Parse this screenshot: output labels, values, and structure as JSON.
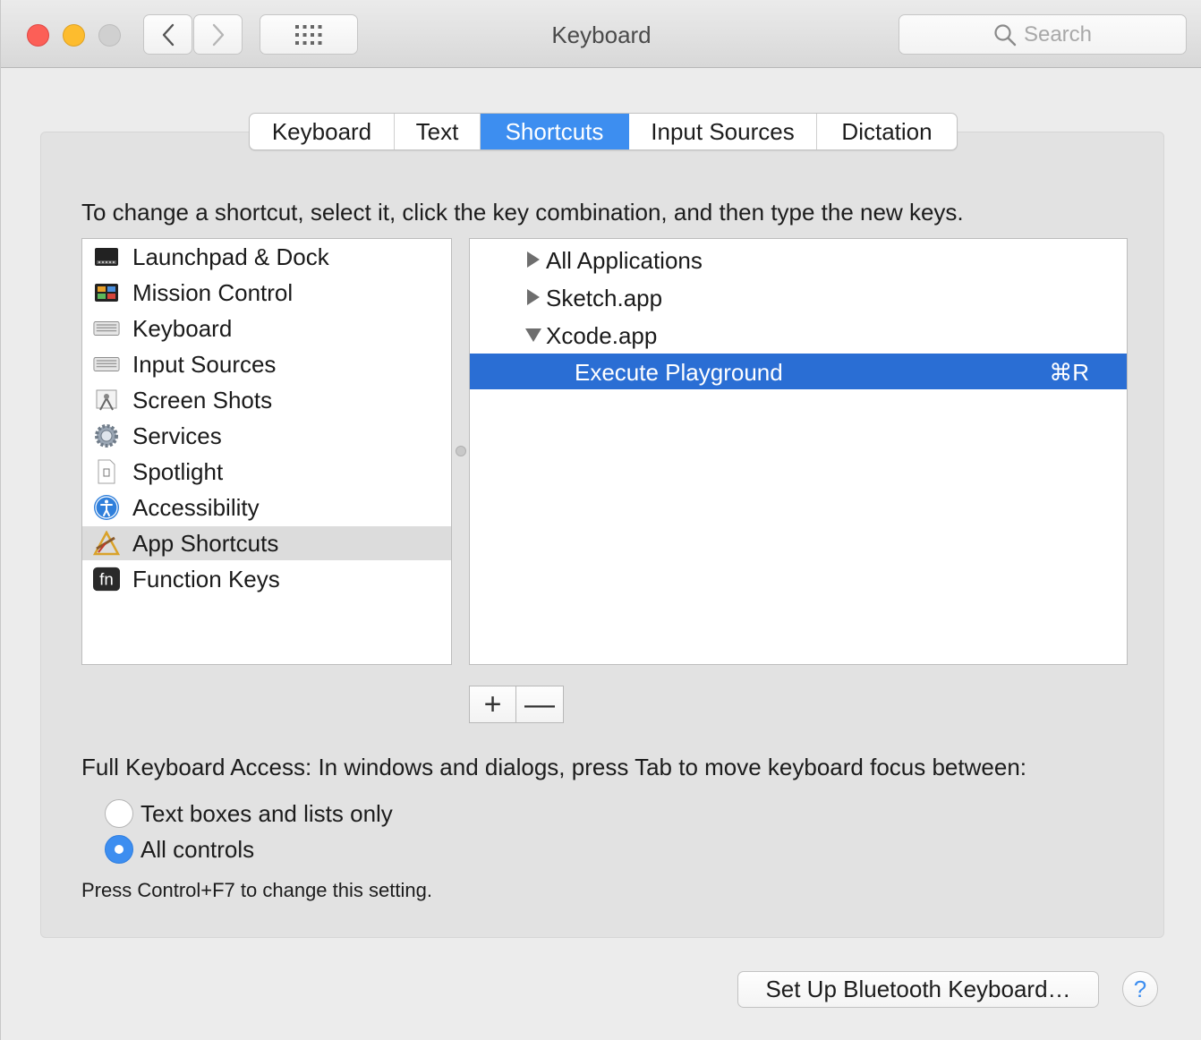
{
  "window": {
    "title": "Keyboard"
  },
  "toolbar": {
    "back_icon": "chevron-left-icon",
    "forward_icon": "chevron-right-icon",
    "grid_icon": "grid-icon",
    "search_placeholder": "Search"
  },
  "tabs": [
    {
      "label": "Keyboard",
      "active": false
    },
    {
      "label": "Text",
      "active": false
    },
    {
      "label": "Shortcuts",
      "active": true
    },
    {
      "label": "Input Sources",
      "active": false
    },
    {
      "label": "Dictation",
      "active": false
    }
  ],
  "instructions": "To change a shortcut, select it, click the key combination, and then type the new keys.",
  "categories": [
    {
      "label": "Launchpad & Dock",
      "icon": "launchpad-dock-icon",
      "selected": false
    },
    {
      "label": "Mission Control",
      "icon": "mission-control-icon",
      "selected": false
    },
    {
      "label": "Keyboard",
      "icon": "keyboard-icon",
      "selected": false
    },
    {
      "label": "Input Sources",
      "icon": "input-sources-icon",
      "selected": false
    },
    {
      "label": "Screen Shots",
      "icon": "screen-shots-icon",
      "selected": false
    },
    {
      "label": "Services",
      "icon": "gear-icon",
      "selected": false
    },
    {
      "label": "Spotlight",
      "icon": "spotlight-icon",
      "selected": false
    },
    {
      "label": "Accessibility",
      "icon": "accessibility-icon",
      "selected": false
    },
    {
      "label": "App Shortcuts",
      "icon": "app-shortcuts-icon",
      "selected": true
    },
    {
      "label": "Function Keys",
      "icon": "fn-key-icon",
      "selected": false
    }
  ],
  "shortcuts": [
    {
      "label": "All Applications",
      "expanded": false
    },
    {
      "label": "Sketch.app",
      "expanded": false
    },
    {
      "label": "Xcode.app",
      "expanded": true
    },
    {
      "label": "Execute Playground",
      "shortcut": "⌘R",
      "selected": true
    }
  ],
  "add_remove": {
    "add": "+",
    "remove": "—"
  },
  "full_keyboard_access": {
    "label": "Full Keyboard Access: In windows and dialogs, press Tab to move keyboard focus between:",
    "options": [
      {
        "label": "Text boxes and lists only",
        "checked": false
      },
      {
        "label": "All controls",
        "checked": true
      }
    ],
    "note": "Press Control+F7 to change this setting."
  },
  "bluetooth_button": "Set Up Bluetooth Keyboard…",
  "help_button": "?",
  "colors": {
    "accent": "#3d8ef0",
    "selection": "#2a6ed4"
  }
}
